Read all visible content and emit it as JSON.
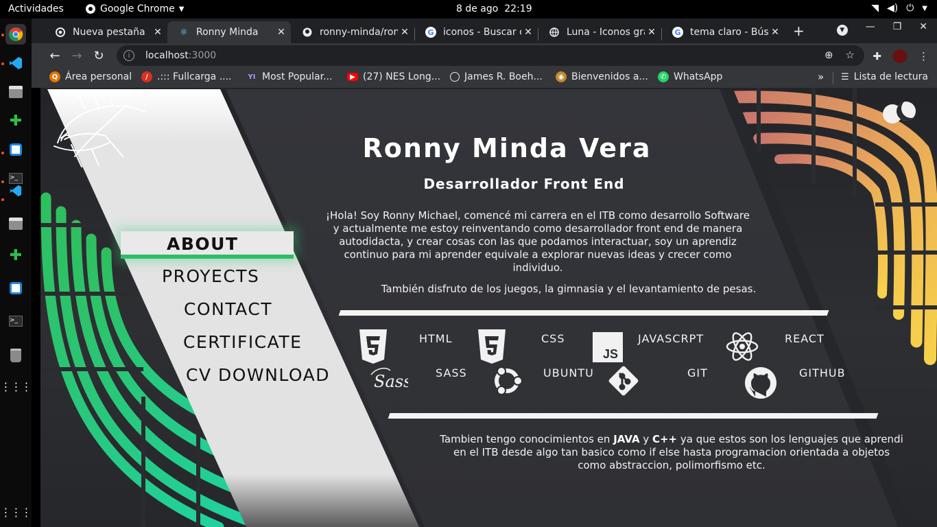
{
  "topbar": {
    "activities": "Actividades",
    "app_name": "Google Chrome",
    "date": "8 de ago",
    "time": "22:19"
  },
  "tabs": [
    {
      "title": "Nueva pestaña",
      "icon": "chrome-icon",
      "active": false
    },
    {
      "title": "Ronny Minda",
      "icon": "react-icon",
      "active": true
    },
    {
      "title": "ronny-minda/ron",
      "icon": "github-icon",
      "active": false
    },
    {
      "title": "iconos - Buscar c",
      "icon": "google-icon",
      "active": false
    },
    {
      "title": "Luna - Iconos gra",
      "icon": "globe-icon",
      "active": false
    },
    {
      "title": "tema claro - Búsq",
      "icon": "google-icon",
      "active": false
    }
  ],
  "address": {
    "host": "localhost",
    "port": ":3000"
  },
  "bookmarks": [
    {
      "label": "Área personal",
      "icon": "q-icon",
      "color": "#e37400"
    },
    {
      "label": ".::: Fullcarga ....",
      "icon": "fullcarga-icon",
      "color": "#d93025"
    },
    {
      "label": "Most Popular...",
      "icon": "yts-icon",
      "color": "#6c5ce7"
    },
    {
      "label": "(27) NES Long...",
      "icon": "youtube-icon",
      "color": "#ff0000"
    },
    {
      "label": "James R. Boeh...",
      "icon": "globe-icon",
      "color": "#5f6368"
    },
    {
      "label": "Bienvenidos a...",
      "icon": "owl-icon",
      "color": "#c4872d"
    },
    {
      "label": "WhatsApp",
      "icon": "whatsapp-icon",
      "color": "#25d366"
    }
  ],
  "reading_list": "Lista de lectura",
  "site": {
    "nav": [
      {
        "label": "ABOUT",
        "active": true
      },
      {
        "label": "PROYECTS",
        "active": false
      },
      {
        "label": "CONTACT",
        "active": false
      },
      {
        "label": "CERTIFICATE",
        "active": false
      },
      {
        "label": "CV DOWNLOAD",
        "active": false
      }
    ],
    "name": "Ronny Minda Vera",
    "role": "Desarrollador Front End",
    "bio_lines": [
      "¡Hola! Soy Ronny Michael, comencé mi carrera en el ITB como desarrollo Software",
      "y actualmente me estoy reinventando como desarrollador front end de manera",
      "autodidacta, y crear cosas con las que podamos interactuar, soy un aprendiz",
      "continuo para mi aprender equivale a explorar nuevas ideas y crecer como",
      "individuo."
    ],
    "hobbies": "También disfruto de los juegos, la gimnasia y el levantamiento de pesas.",
    "skills": {
      "html": "HTML",
      "css": "CSS",
      "javascript": "JAVASCRPT",
      "react": "REACT",
      "sass": "SASS",
      "ubuntu": "UBUNTU",
      "git": "GIT",
      "github": "GITHUB"
    },
    "extra": {
      "t1": "Tambien tengo conocimientos en ",
      "java": "JAVA",
      "t2": " y ",
      "cpp": "C++",
      "t3": " ya que estos son los lenguajes que aprendi",
      "line2": "en el ITB desde algo tan basico como if else hasta programacion orientada a objetos",
      "line3": "como abstraccion, polimorfismo etc."
    },
    "colors": {
      "accent_green": "#2ebd6b",
      "nav_panel": "#e6e6e6",
      "card_dark": "#323337"
    }
  }
}
